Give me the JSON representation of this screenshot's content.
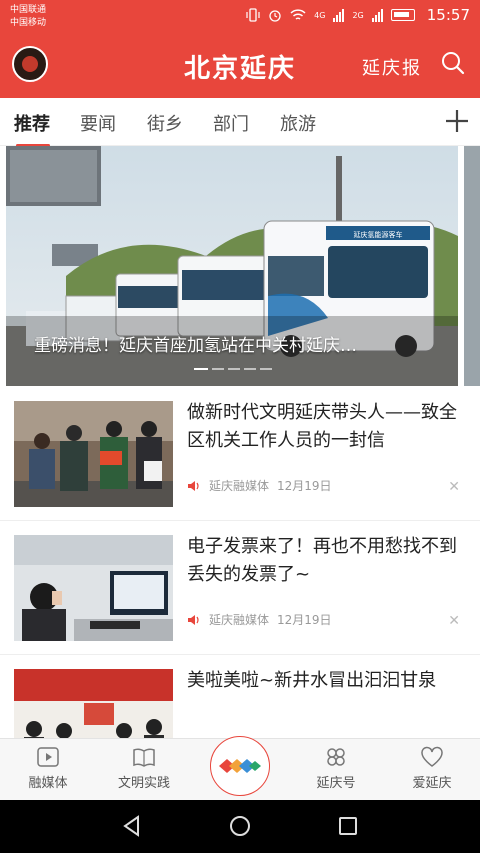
{
  "status_bar": {
    "carrier_1": "中国联通",
    "carrier_2": "中国移动",
    "network_1": "4G",
    "network_2": "2G",
    "time": "15:57"
  },
  "header": {
    "title": "北京延庆",
    "paper_link": "延庆报",
    "accent_color": "#e8463c"
  },
  "tabs": [
    {
      "label": "推荐",
      "active": true
    },
    {
      "label": "要闻"
    },
    {
      "label": "街乡"
    },
    {
      "label": "部门"
    },
    {
      "label": "旅游"
    }
  ],
  "banner": {
    "caption": "重磅消息！延庆首座加氢站在中关村延庆…",
    "bus_sign": "延庆氢能源客车"
  },
  "news": [
    {
      "title": "做新时代文明延庆带头人——致全区机关工作人员的一封信",
      "source": "延庆融媒体",
      "date": "12月19日"
    },
    {
      "title": "电子发票来了！再也不用愁找不到丢失的发票了~",
      "source": "延庆融媒体",
      "date": "12月19日"
    },
    {
      "title": "美啦美啦~新井水冒出汩汩甘泉"
    }
  ],
  "bottom_nav": [
    {
      "label": "融媒体",
      "icon": "play-icon"
    },
    {
      "label": "文明实践",
      "icon": "book-icon"
    },
    {
      "label": "",
      "icon": "center-logo-icon"
    },
    {
      "label": "延庆号",
      "icon": "clover-icon"
    },
    {
      "label": "爱延庆",
      "icon": "heart-icon"
    }
  ]
}
